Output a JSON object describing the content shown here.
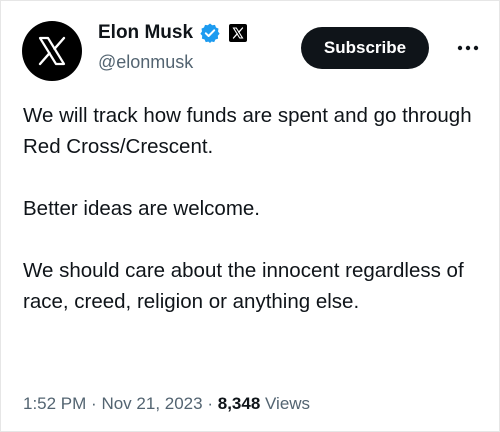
{
  "author": {
    "display_name": "Elon Musk",
    "handle": "@elonmusk",
    "avatar_icon": "x-logo-icon",
    "verified_icon": "verified-badge-icon",
    "affiliate_icon": "x-affiliate-icon"
  },
  "actions": {
    "subscribe_label": "Subscribe",
    "more_icon": "more-icon"
  },
  "tweet": {
    "paragraphs": [
      "We will track how funds are spent and go through Red Cross/Crescent.",
      "Better ideas are welcome.",
      "We should care about the innocent regardless of race, creed, religion or anything else."
    ]
  },
  "meta": {
    "time": "1:52 PM",
    "separator1": "·",
    "date": "Nov 21, 2023",
    "separator2": "·",
    "views_count": "8,348",
    "views_label": "Views"
  },
  "colors": {
    "text_primary": "#0f1419",
    "text_secondary": "#536471",
    "verified_blue": "#1d9bf0",
    "button_bg": "#0f1419"
  }
}
